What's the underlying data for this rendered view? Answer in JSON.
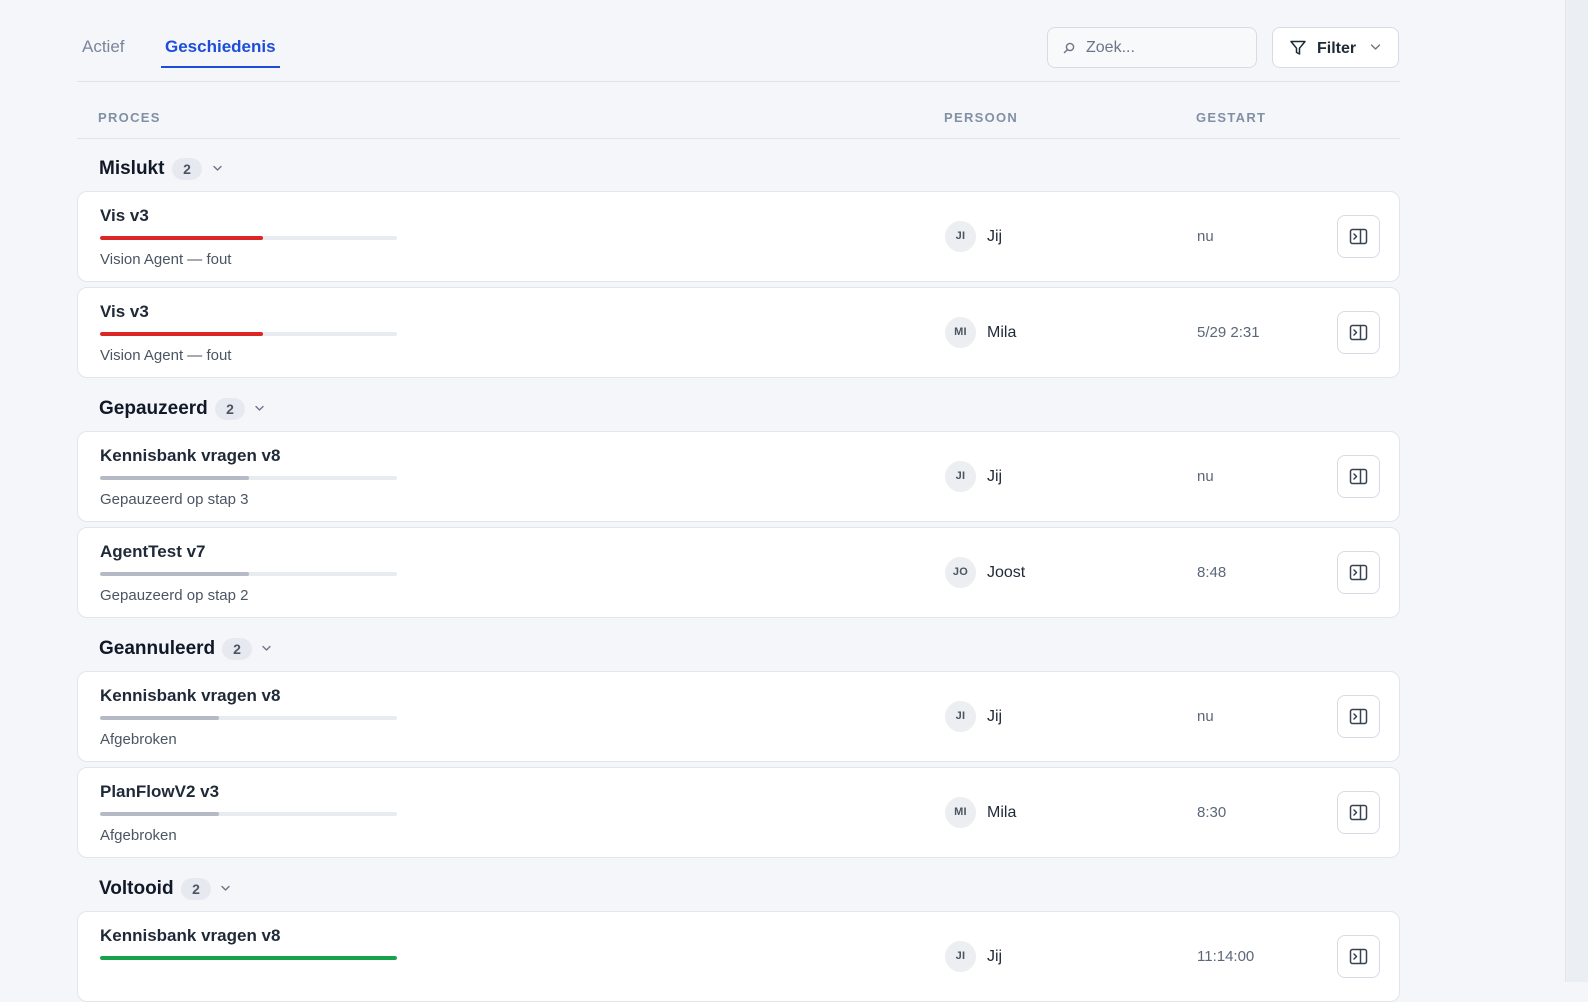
{
  "tabs": {
    "active_label": "Actief",
    "history_label": "Geschiedenis"
  },
  "search": {
    "placeholder": "Zoek..."
  },
  "filter": {
    "label": "Filter"
  },
  "columns": {
    "process": "PROCES",
    "person": "PERSOON",
    "started": "GESTART"
  },
  "colors": {
    "accent": "#1d4ed8",
    "failed": "#dc2626",
    "neutral": "#b4bac6",
    "done": "#16a34a"
  },
  "icons": {
    "search": "search-icon",
    "filter": "filter-icon",
    "chevron": "chevron-down-icon",
    "panel": "panel-open-icon"
  },
  "groups": [
    {
      "title": "Mislukt",
      "count": "2",
      "rows": [
        {
          "name": "Vis v3",
          "status": "Vision Agent — fout",
          "progress": 0.55,
          "color": "failed",
          "initials": "JI",
          "person": "Jij",
          "started": "nu"
        },
        {
          "name": "Vis v3",
          "status": "Vision Agent — fout",
          "progress": 0.55,
          "color": "failed",
          "initials": "MI",
          "person": "Mila",
          "started": "5/29 2:31"
        }
      ]
    },
    {
      "title": "Gepauzeerd",
      "count": "2",
      "rows": [
        {
          "name": "Kennisbank vragen v8",
          "status": "Gepauzeerd op stap 3",
          "progress": 0.5,
          "color": "neutral",
          "initials": "JI",
          "person": "Jij",
          "started": "nu"
        },
        {
          "name": "AgentTest v7",
          "status": "Gepauzeerd op stap 2",
          "progress": 0.5,
          "color": "neutral",
          "initials": "JO",
          "person": "Joost",
          "started": "8:48"
        }
      ]
    },
    {
      "title": "Geannuleerd",
      "count": "2",
      "rows": [
        {
          "name": "Kennisbank vragen v8",
          "status": "Afgebroken",
          "progress": 0.4,
          "color": "neutral",
          "initials": "JI",
          "person": "Jij",
          "started": "nu"
        },
        {
          "name": "PlanFlowV2 v3",
          "status": "Afgebroken",
          "progress": 0.4,
          "color": "neutral",
          "initials": "MI",
          "person": "Mila",
          "started": "8:30"
        }
      ]
    },
    {
      "title": "Voltooid",
      "count": "2",
      "rows": [
        {
          "name": "Kennisbank vragen v8",
          "status": "",
          "progress": 1.0,
          "color": "done",
          "initials": "JI",
          "person": "Jij",
          "started": "11:14:00"
        }
      ]
    }
  ]
}
